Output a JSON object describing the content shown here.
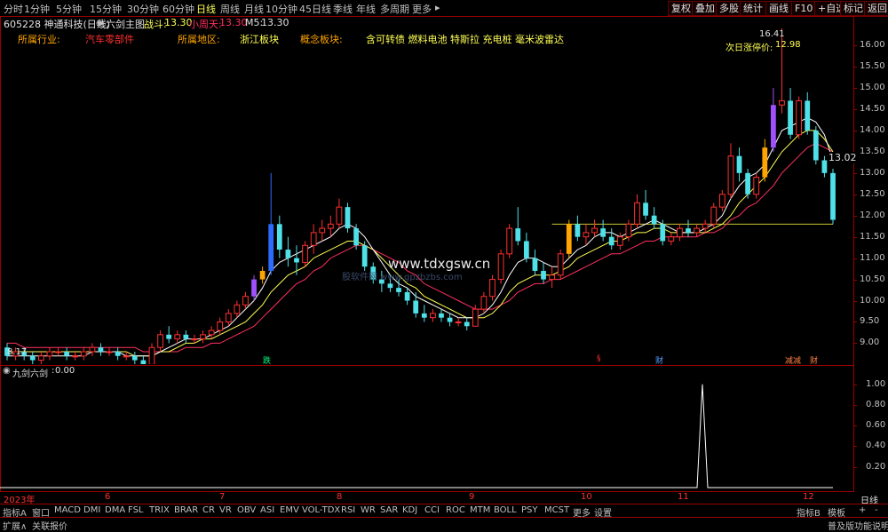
{
  "timeframes": [
    "分时",
    "1分钟",
    "5分钟",
    "15分钟",
    "30分钟",
    "60分钟",
    "日线",
    "周线",
    "月线",
    "10分钟",
    "45日线",
    "季线",
    "年线",
    "多周期",
    "更多"
  ],
  "active_timeframe": "日线",
  "toolbar_buttons": [
    "复权",
    "叠加",
    "多股",
    "统计",
    "画线",
    "F10",
    "+自选",
    "标记",
    "返回"
  ],
  "stock": {
    "code_name": "605228 神通科技(日线)",
    "indicator": "六剑主图",
    "zhandou_label": "战斗:",
    "zhandou_value": "13.30",
    "xiaozhoutian_label": "小周天:",
    "xiaozhoutian_value": "13.30",
    "m5_label": "M5:",
    "m5_value": "13.30"
  },
  "info": {
    "industry_label": "所属行业:",
    "industry_value": "汽车零部件",
    "region_label": "所属地区:",
    "region_value": "浙江板块",
    "concept_label": "概念板块:",
    "concept_value": "含可转债 燃料电池 特斯拉 充电桩 毫米波雷达"
  },
  "annotations": {
    "high_label": "16.41",
    "limit_label": "次日涨停价:",
    "limit_value": "12.98",
    "last_price": "13.02",
    "low_label": "8.17",
    "watermark": "www.tdxgsw.cn",
    "watermark2": "股软件网 www.gpzbzbs.com"
  },
  "markers": [
    "跌",
    "§",
    "财",
    "减减",
    "财"
  ],
  "price_axis": [
    "16.00",
    "15.50",
    "15.00",
    "14.50",
    "14.00",
    "13.50",
    "13.00",
    "12.50",
    "12.00",
    "11.50",
    "11.00",
    "10.50",
    "10.00",
    "9.50",
    "9.00"
  ],
  "sub_indicator": {
    "name": "九剑六剑",
    "value": "0.00",
    "axis": [
      "1.00",
      "0.80",
      "0.60",
      "0.40",
      "0.20"
    ]
  },
  "date_labels": [
    "2023年",
    "6",
    "7",
    "8",
    "9",
    "10",
    "11",
    "12"
  ],
  "period_label": "日线",
  "bottom_tabs": [
    "指标A",
    "窗口",
    "MACD",
    "DMI",
    "DMA",
    "FSL",
    "TRIX",
    "BRAR",
    "CR",
    "VR",
    "OBV",
    "ASI",
    "EMV",
    "VOL-TDX",
    "RSI",
    "WR",
    "SAR",
    "KDJ",
    "CCI",
    "ROC",
    "MTM",
    "BOLL",
    "PSY",
    "MCST",
    "更多",
    "设置"
  ],
  "bottom_right": [
    "指标B",
    "模板",
    "+",
    "-"
  ],
  "status_bar": {
    "expand": "扩展∧",
    "related": "关联报价",
    "help": "普及版功能说明"
  },
  "colors": {
    "up": "#ff3030",
    "down": "#4fe0e8",
    "ma_white": "#ffffff",
    "ma_yellow": "#ffff54",
    "ma_red": "#ff3060",
    "grid": "#9a0000",
    "signal_orange": "#ffa500",
    "signal_blue": "#2d6bff",
    "signal_purple": "#a050ff"
  },
  "chart_data": [
    {
      "type": "candlestick",
      "title": "",
      "ylim": [
        8.8,
        16.4
      ],
      "note_series": [
        "candles",
        "ma_white",
        "ma_yellow",
        "ma_red"
      ],
      "candles": [
        [
          8.9,
          9.0,
          8.6,
          8.7
        ],
        [
          8.7,
          8.9,
          8.6,
          8.8
        ],
        [
          8.8,
          8.9,
          8.6,
          8.7
        ],
        [
          8.7,
          8.8,
          8.5,
          8.6
        ],
        [
          8.6,
          8.8,
          8.5,
          8.7
        ],
        [
          8.7,
          8.9,
          8.6,
          8.8
        ],
        [
          8.8,
          8.9,
          8.7,
          8.8
        ],
        [
          8.8,
          8.9,
          8.6,
          8.7
        ],
        [
          8.7,
          8.8,
          8.6,
          8.7
        ],
        [
          8.7,
          8.9,
          8.6,
          8.8
        ],
        [
          8.8,
          9.0,
          8.7,
          8.9
        ],
        [
          8.9,
          9.0,
          8.7,
          8.8
        ],
        [
          8.8,
          8.9,
          8.7,
          8.8
        ],
        [
          8.8,
          8.9,
          8.6,
          8.7
        ],
        [
          8.7,
          8.8,
          8.6,
          8.7
        ],
        [
          8.7,
          8.8,
          8.5,
          8.6
        ],
        [
          8.6,
          8.7,
          8.4,
          8.5
        ],
        [
          8.5,
          9.0,
          8.5,
          8.9
        ],
        [
          8.9,
          9.3,
          8.8,
          9.2
        ],
        [
          9.2,
          9.4,
          9.0,
          9.1
        ],
        [
          9.1,
          9.3,
          9.0,
          9.2
        ],
        [
          9.2,
          9.3,
          9.0,
          9.1
        ],
        [
          9.1,
          9.2,
          9.0,
          9.1
        ],
        [
          9.1,
          9.3,
          9.0,
          9.2
        ],
        [
          9.2,
          9.4,
          9.1,
          9.3
        ],
        [
          9.3,
          9.6,
          9.2,
          9.5
        ],
        [
          9.5,
          9.8,
          9.4,
          9.7
        ],
        [
          9.7,
          10.0,
          9.6,
          9.9
        ],
        [
          9.9,
          10.2,
          9.8,
          10.1
        ],
        [
          10.1,
          10.6,
          10.0,
          10.5
        ],
        [
          10.5,
          10.8,
          10.4,
          10.7
        ],
        [
          10.7,
          13.0,
          10.6,
          11.8
        ],
        [
          11.8,
          12.0,
          11.0,
          11.2
        ],
        [
          11.2,
          11.5,
          10.8,
          11.0
        ],
        [
          11.0,
          11.3,
          10.6,
          10.9
        ],
        [
          10.9,
          11.4,
          10.8,
          11.3
        ],
        [
          11.3,
          11.8,
          11.1,
          11.6
        ],
        [
          11.6,
          11.9,
          11.4,
          11.7
        ],
        [
          11.7,
          12.0,
          11.5,
          11.8
        ],
        [
          11.8,
          12.4,
          11.7,
          12.2
        ],
        [
          12.2,
          12.3,
          11.6,
          11.7
        ],
        [
          11.7,
          11.8,
          11.2,
          11.3
        ],
        [
          11.3,
          11.4,
          10.7,
          10.8
        ],
        [
          10.8,
          10.9,
          10.4,
          10.5
        ],
        [
          10.5,
          10.7,
          10.2,
          10.4
        ],
        [
          10.4,
          10.6,
          10.2,
          10.3
        ],
        [
          10.3,
          10.5,
          10.1,
          10.2
        ],
        [
          10.2,
          10.3,
          9.9,
          10.0
        ],
        [
          10.0,
          10.2,
          9.6,
          9.7
        ],
        [
          9.7,
          9.9,
          9.5,
          9.6
        ],
        [
          9.6,
          9.8,
          9.5,
          9.7
        ],
        [
          9.7,
          9.8,
          9.5,
          9.6
        ],
        [
          9.6,
          9.7,
          9.4,
          9.5
        ],
        [
          9.5,
          9.6,
          9.4,
          9.5
        ],
        [
          9.5,
          9.6,
          9.3,
          9.4
        ],
        [
          9.4,
          9.9,
          9.4,
          9.8
        ],
        [
          9.8,
          10.2,
          9.7,
          10.1
        ],
        [
          10.1,
          10.6,
          10.0,
          10.5
        ],
        [
          10.5,
          11.2,
          10.4,
          11.1
        ],
        [
          11.1,
          11.8,
          11.0,
          11.7
        ],
        [
          11.7,
          12.2,
          11.3,
          11.4
        ],
        [
          11.4,
          11.6,
          10.9,
          11.0
        ],
        [
          11.0,
          11.2,
          10.6,
          10.7
        ],
        [
          10.7,
          10.9,
          10.4,
          10.5
        ],
        [
          10.5,
          10.8,
          10.3,
          10.6
        ],
        [
          10.6,
          11.2,
          10.5,
          11.1
        ],
        [
          11.1,
          11.9,
          11.0,
          11.8
        ],
        [
          11.8,
          12.0,
          11.4,
          11.5
        ],
        [
          11.5,
          11.8,
          11.3,
          11.6
        ],
        [
          11.6,
          11.9,
          11.5,
          11.7
        ],
        [
          11.7,
          11.9,
          11.4,
          11.5
        ],
        [
          11.5,
          11.7,
          11.2,
          11.3
        ],
        [
          11.3,
          11.6,
          11.2,
          11.5
        ],
        [
          11.5,
          11.9,
          11.4,
          11.8
        ],
        [
          11.8,
          12.5,
          11.7,
          12.3
        ],
        [
          12.3,
          12.6,
          11.9,
          12.0
        ],
        [
          12.0,
          12.2,
          11.7,
          11.8
        ],
        [
          11.8,
          11.9,
          11.3,
          11.4
        ],
        [
          11.4,
          11.6,
          11.3,
          11.5
        ],
        [
          11.5,
          11.8,
          11.4,
          11.7
        ],
        [
          11.7,
          11.9,
          11.5,
          11.6
        ],
        [
          11.6,
          11.8,
          11.5,
          11.7
        ],
        [
          11.7,
          11.9,
          11.6,
          11.8
        ],
        [
          11.8,
          12.3,
          11.7,
          12.2
        ],
        [
          12.2,
          12.6,
          12.1,
          12.5
        ],
        [
          12.5,
          13.7,
          12.4,
          13.4
        ],
        [
          13.4,
          13.6,
          12.8,
          13.0
        ],
        [
          13.0,
          13.1,
          12.4,
          12.5
        ],
        [
          12.5,
          13.0,
          12.4,
          12.9
        ],
        [
          12.9,
          13.8,
          12.8,
          13.6
        ],
        [
          13.6,
          15.0,
          13.5,
          14.6
        ],
        [
          14.6,
          16.4,
          14.4,
          14.7
        ],
        [
          14.7,
          15.0,
          13.8,
          13.9
        ],
        [
          13.9,
          14.8,
          13.8,
          14.7
        ],
        [
          14.7,
          14.9,
          13.9,
          14.0
        ],
        [
          14.0,
          14.1,
          13.2,
          13.3
        ],
        [
          13.3,
          13.4,
          12.9,
          13.0
        ],
        [
          13.0,
          13.1,
          11.8,
          11.9
        ]
      ],
      "ma_white": [
        8.7,
        8.7,
        8.7,
        8.7,
        8.7,
        8.7,
        8.7,
        8.7,
        8.7,
        8.7,
        8.8,
        8.8,
        8.8,
        8.8,
        8.7,
        8.7,
        8.7,
        8.7,
        8.8,
        8.9,
        9.0,
        9.1,
        9.1,
        9.1,
        9.2,
        9.3,
        9.4,
        9.6,
        9.8,
        10.0,
        10.3,
        10.7,
        10.9,
        11.0,
        11.1,
        11.2,
        11.3,
        11.4,
        11.5,
        11.7,
        11.8,
        11.7,
        11.5,
        11.2,
        10.9,
        10.6,
        10.4,
        10.3,
        10.1,
        10.0,
        9.9,
        9.8,
        9.7,
        9.6,
        9.6,
        9.6,
        9.7,
        9.9,
        10.2,
        10.6,
        10.9,
        11.0,
        11.0,
        10.9,
        10.8,
        10.8,
        11.0,
        11.2,
        11.3,
        11.5,
        11.6,
        11.6,
        11.5,
        11.6,
        11.7,
        11.8,
        11.9,
        11.8,
        11.7,
        11.6,
        11.6,
        11.6,
        11.7,
        11.8,
        12.0,
        12.4,
        12.7,
        12.9,
        13.0,
        13.2,
        13.6,
        14.0,
        14.1,
        14.2,
        14.3,
        14.2,
        13.9,
        13.3
      ],
      "ma_yellow": [
        8.8,
        8.8,
        8.8,
        8.8,
        8.8,
        8.8,
        8.8,
        8.8,
        8.8,
        8.8,
        8.8,
        8.8,
        8.8,
        8.8,
        8.8,
        8.7,
        8.7,
        8.7,
        8.8,
        8.8,
        8.9,
        9.0,
        9.0,
        9.1,
        9.1,
        9.2,
        9.3,
        9.4,
        9.5,
        9.7,
        9.9,
        10.2,
        10.4,
        10.6,
        10.7,
        10.8,
        11.0,
        11.1,
        11.2,
        11.3,
        11.4,
        11.4,
        11.3,
        11.2,
        11.0,
        10.8,
        10.6,
        10.4,
        10.3,
        10.1,
        10.0,
        9.9,
        9.8,
        9.7,
        9.6,
        9.6,
        9.6,
        9.7,
        9.9,
        10.2,
        10.4,
        10.5,
        10.6,
        10.6,
        10.6,
        10.7,
        10.8,
        11.0,
        11.1,
        11.2,
        11.3,
        11.4,
        11.4,
        11.5,
        11.6,
        11.6,
        11.7,
        11.7,
        11.6,
        11.6,
        11.6,
        11.6,
        11.6,
        11.7,
        11.8,
        12.0,
        12.3,
        12.5,
        12.7,
        12.9,
        13.2,
        13.5,
        13.7,
        13.9,
        14.0,
        14.0,
        13.8,
        13.5
      ],
      "ma_red": [
        9.0,
        9.0,
        8.9,
        8.9,
        8.9,
        8.9,
        8.9,
        8.9,
        8.9,
        8.9,
        8.9,
        8.9,
        8.9,
        8.9,
        8.9,
        8.9,
        8.8,
        8.8,
        8.8,
        8.8,
        8.8,
        8.9,
        8.9,
        8.9,
        9.0,
        9.0,
        9.1,
        9.2,
        9.3,
        9.4,
        9.6,
        9.8,
        10.0,
        10.2,
        10.4,
        10.5,
        10.7,
        10.8,
        11.0,
        11.1,
        11.2,
        11.3,
        11.3,
        11.2,
        11.1,
        11.0,
        10.9,
        10.7,
        10.6,
        10.4,
        10.3,
        10.2,
        10.1,
        10.0,
        9.9,
        9.8,
        9.8,
        9.8,
        9.9,
        10.0,
        10.2,
        10.3,
        10.4,
        10.4,
        10.5,
        10.5,
        10.6,
        10.7,
        10.8,
        10.9,
        11.0,
        11.1,
        11.1,
        11.2,
        11.3,
        11.4,
        11.4,
        11.5,
        11.5,
        11.5,
        11.5,
        11.5,
        11.6,
        11.6,
        11.7,
        11.9,
        12.0,
        12.2,
        12.3,
        12.5,
        12.7,
        13.0,
        13.2,
        13.4,
        13.6,
        13.7,
        13.6,
        13.5
      ]
    },
    {
      "type": "line",
      "title": "",
      "ylim": [
        0,
        1.1
      ],
      "note": "sub-indicator signal: 0 except one spike to 1.00 shortly after November"
    }
  ]
}
